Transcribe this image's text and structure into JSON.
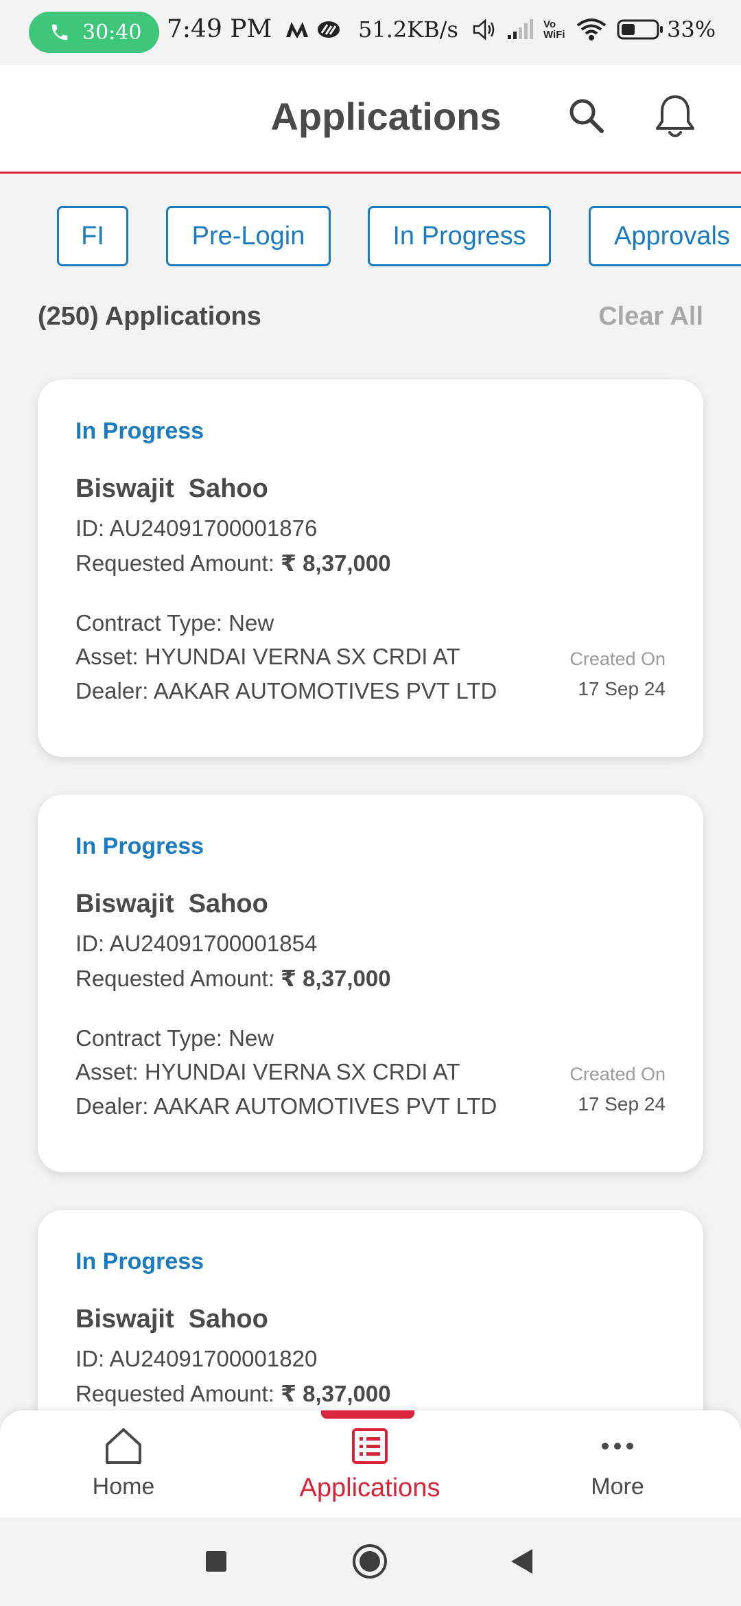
{
  "status_bar": {
    "call_timer": "30:40",
    "time": "7:49 PM",
    "net_speed": "51.2KB/s",
    "vowifi": "Vo WiFi",
    "battery": "33%"
  },
  "header": {
    "title": "Applications"
  },
  "filters": [
    "FI",
    "Pre-Login",
    "In Progress",
    "Approvals"
  ],
  "summary": {
    "count_text": "(250) Applications",
    "clear_all": "Clear All"
  },
  "cards": [
    {
      "status": "In Progress",
      "name": "Biswajit  Sahoo",
      "id_text": "ID: AU24091700001876",
      "amount_label": "Requested Amount: ",
      "amount_value": "₹ 8,37,000",
      "contract": "Contract Type: New",
      "asset": "Asset: HYUNDAI VERNA SX CRDI AT",
      "dealer": "Dealer: AAKAR AUTOMOTIVES PVT LTD",
      "created_label": "Created On",
      "created_date": "17 Sep 24"
    },
    {
      "status": "In Progress",
      "name": "Biswajit  Sahoo",
      "id_text": "ID: AU24091700001854",
      "amount_label": "Requested Amount: ",
      "amount_value": "₹ 8,37,000",
      "contract": "Contract Type: New",
      "asset": "Asset: HYUNDAI VERNA SX CRDI AT",
      "dealer": "Dealer: AAKAR AUTOMOTIVES PVT LTD",
      "created_label": "Created On",
      "created_date": "17 Sep 24"
    },
    {
      "status": "In Progress",
      "name": "Biswajit  Sahoo",
      "id_text": "ID: AU24091700001820",
      "amount_label": "Requested Amount: ",
      "amount_value": "₹ 8,37,000"
    }
  ],
  "bottom_nav": {
    "home": "Home",
    "applications": "Applications",
    "more": "More"
  },
  "colors": {
    "accent": "#d9243a",
    "link": "#1a7bc0",
    "call_green": "#3ec67a"
  }
}
